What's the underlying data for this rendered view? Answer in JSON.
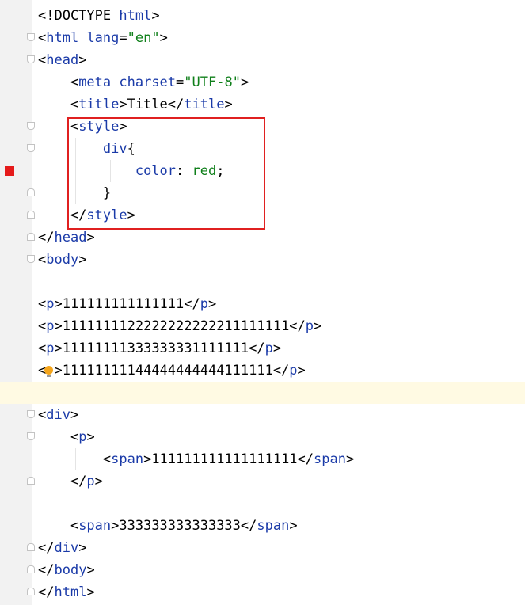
{
  "editor": {
    "colors": {
      "tag": "#1a3aa8",
      "attribute": "#1a3aa8",
      "string": "#0f7f1a",
      "text": "#000000",
      "highlight_box": "#e02020",
      "breakpoint": "#e51b1b",
      "current_line": "#fffae3"
    },
    "lines": [
      {
        "tokens": [
          {
            "c": "p",
            "v": "<!DOCTYPE "
          },
          {
            "c": "t",
            "v": "html"
          },
          {
            "c": "p",
            "v": ">"
          }
        ]
      },
      {
        "tokens": [
          {
            "c": "p",
            "v": "<"
          },
          {
            "c": "t",
            "v": "html "
          },
          {
            "c": "a",
            "v": "lang"
          },
          {
            "c": "p",
            "v": "="
          },
          {
            "c": "s",
            "v": "\"en\""
          },
          {
            "c": "p",
            "v": ">"
          }
        ]
      },
      {
        "tokens": [
          {
            "c": "p",
            "v": "<"
          },
          {
            "c": "t",
            "v": "head"
          },
          {
            "c": "p",
            "v": ">"
          }
        ]
      },
      {
        "tokens": [
          {
            "c": "p",
            "v": "    <"
          },
          {
            "c": "t",
            "v": "meta "
          },
          {
            "c": "a",
            "v": "charset"
          },
          {
            "c": "p",
            "v": "="
          },
          {
            "c": "s",
            "v": "\"UTF-8\""
          },
          {
            "c": "p",
            "v": ">"
          }
        ]
      },
      {
        "tokens": [
          {
            "c": "p",
            "v": "    <"
          },
          {
            "c": "t",
            "v": "title"
          },
          {
            "c": "p",
            "v": ">Title</"
          },
          {
            "c": "t",
            "v": "title"
          },
          {
            "c": "p",
            "v": ">"
          }
        ]
      },
      {
        "tokens": [
          {
            "c": "p",
            "v": "    <"
          },
          {
            "c": "t",
            "v": "style"
          },
          {
            "c": "p",
            "v": ">"
          }
        ]
      },
      {
        "tokens": [
          {
            "c": "p",
            "v": "        "
          },
          {
            "c": "t",
            "v": "div"
          },
          {
            "c": "p",
            "v": "{"
          }
        ]
      },
      {
        "tokens": [
          {
            "c": "p",
            "v": "            "
          },
          {
            "c": "a",
            "v": "color"
          },
          {
            "c": "p",
            "v": ": "
          },
          {
            "c": "s",
            "v": "red"
          },
          {
            "c": "p",
            "v": ";"
          }
        ]
      },
      {
        "tokens": [
          {
            "c": "p",
            "v": "        }"
          }
        ]
      },
      {
        "tokens": [
          {
            "c": "p",
            "v": "    </"
          },
          {
            "c": "t",
            "v": "style"
          },
          {
            "c": "p",
            "v": ">"
          }
        ]
      },
      {
        "tokens": [
          {
            "c": "p",
            "v": "</"
          },
          {
            "c": "t",
            "v": "head"
          },
          {
            "c": "p",
            "v": ">"
          }
        ]
      },
      {
        "tokens": [
          {
            "c": "p",
            "v": "<"
          },
          {
            "c": "t",
            "v": "body"
          },
          {
            "c": "p",
            "v": ">"
          }
        ]
      },
      {
        "tokens": []
      },
      {
        "tokens": [
          {
            "c": "p",
            "v": "<"
          },
          {
            "c": "t",
            "v": "p"
          },
          {
            "c": "p",
            "v": ">111111111111111</"
          },
          {
            "c": "t",
            "v": "p"
          },
          {
            "c": "p",
            "v": ">"
          }
        ]
      },
      {
        "tokens": [
          {
            "c": "p",
            "v": "<"
          },
          {
            "c": "t",
            "v": "p"
          },
          {
            "c": "p",
            "v": ">1111111122222222222211111111</"
          },
          {
            "c": "t",
            "v": "p"
          },
          {
            "c": "p",
            "v": ">"
          }
        ]
      },
      {
        "tokens": [
          {
            "c": "p",
            "v": "<"
          },
          {
            "c": "t",
            "v": "p"
          },
          {
            "c": "p",
            "v": ">11111111333333331111111</"
          },
          {
            "c": "t",
            "v": "p"
          },
          {
            "c": "p",
            "v": ">"
          }
        ]
      },
      {
        "tokens": [
          {
            "c": "p",
            "v": "< "
          },
          {
            "c": "p",
            "v": ">11111111144444444444111111</"
          },
          {
            "c": "t",
            "v": "p"
          },
          {
            "c": "p",
            "v": ">"
          }
        ]
      },
      {
        "tokens": []
      },
      {
        "tokens": [
          {
            "c": "p",
            "v": "<"
          },
          {
            "c": "t",
            "v": "div"
          },
          {
            "c": "p",
            "v": ">"
          }
        ]
      },
      {
        "tokens": [
          {
            "c": "p",
            "v": "    <"
          },
          {
            "c": "t",
            "v": "p"
          },
          {
            "c": "p",
            "v": ">"
          }
        ]
      },
      {
        "tokens": [
          {
            "c": "p",
            "v": "        <"
          },
          {
            "c": "t",
            "v": "span"
          },
          {
            "c": "p",
            "v": ">111111111111111111</"
          },
          {
            "c": "t",
            "v": "span"
          },
          {
            "c": "p",
            "v": ">"
          }
        ]
      },
      {
        "tokens": [
          {
            "c": "p",
            "v": "    </"
          },
          {
            "c": "t",
            "v": "p"
          },
          {
            "c": "p",
            "v": ">"
          }
        ]
      },
      {
        "tokens": []
      },
      {
        "tokens": [
          {
            "c": "p",
            "v": "    <"
          },
          {
            "c": "t",
            "v": "span"
          },
          {
            "c": "p",
            "v": ">333333333333333</"
          },
          {
            "c": "t",
            "v": "span"
          },
          {
            "c": "p",
            "v": ">"
          }
        ]
      },
      {
        "tokens": [
          {
            "c": "p",
            "v": "</"
          },
          {
            "c": "t",
            "v": "div"
          },
          {
            "c": "p",
            "v": ">"
          }
        ]
      },
      {
        "tokens": [
          {
            "c": "p",
            "v": "</"
          },
          {
            "c": "t",
            "v": "body"
          },
          {
            "c": "p",
            "v": ">"
          }
        ]
      },
      {
        "tokens": [
          {
            "c": "p",
            "v": "</"
          },
          {
            "c": "t",
            "v": "html"
          },
          {
            "c": "p",
            "v": ">"
          }
        ]
      }
    ]
  },
  "gutter": {
    "breakpoint_icon": "breakpoint-icon",
    "fold_icon": "fold-marker-icon",
    "intention_icon": "lightbulb-icon"
  }
}
